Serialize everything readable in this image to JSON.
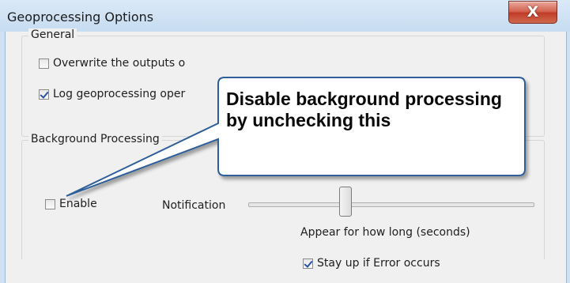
{
  "window": {
    "title": "Geoprocessing Options",
    "close_glyph": "X"
  },
  "general": {
    "label": "General",
    "options": [
      {
        "label": "Overwrite the outputs o",
        "checked": false
      },
      {
        "label": "Log geoprocessing oper",
        "checked": true
      }
    ]
  },
  "background": {
    "label": "Background Processing",
    "enable": {
      "label": "Enable",
      "checked": false
    },
    "notification": {
      "label": "Notification",
      "caption": "Appear for how long (seconds)"
    },
    "stay_up": {
      "label": "Stay up if Error occurs",
      "checked": true
    }
  },
  "callout": {
    "text": "Disable background processing by unchecking this"
  },
  "colors": {
    "callout_border": "#2f5f9a",
    "close_button": "#c84a36"
  }
}
